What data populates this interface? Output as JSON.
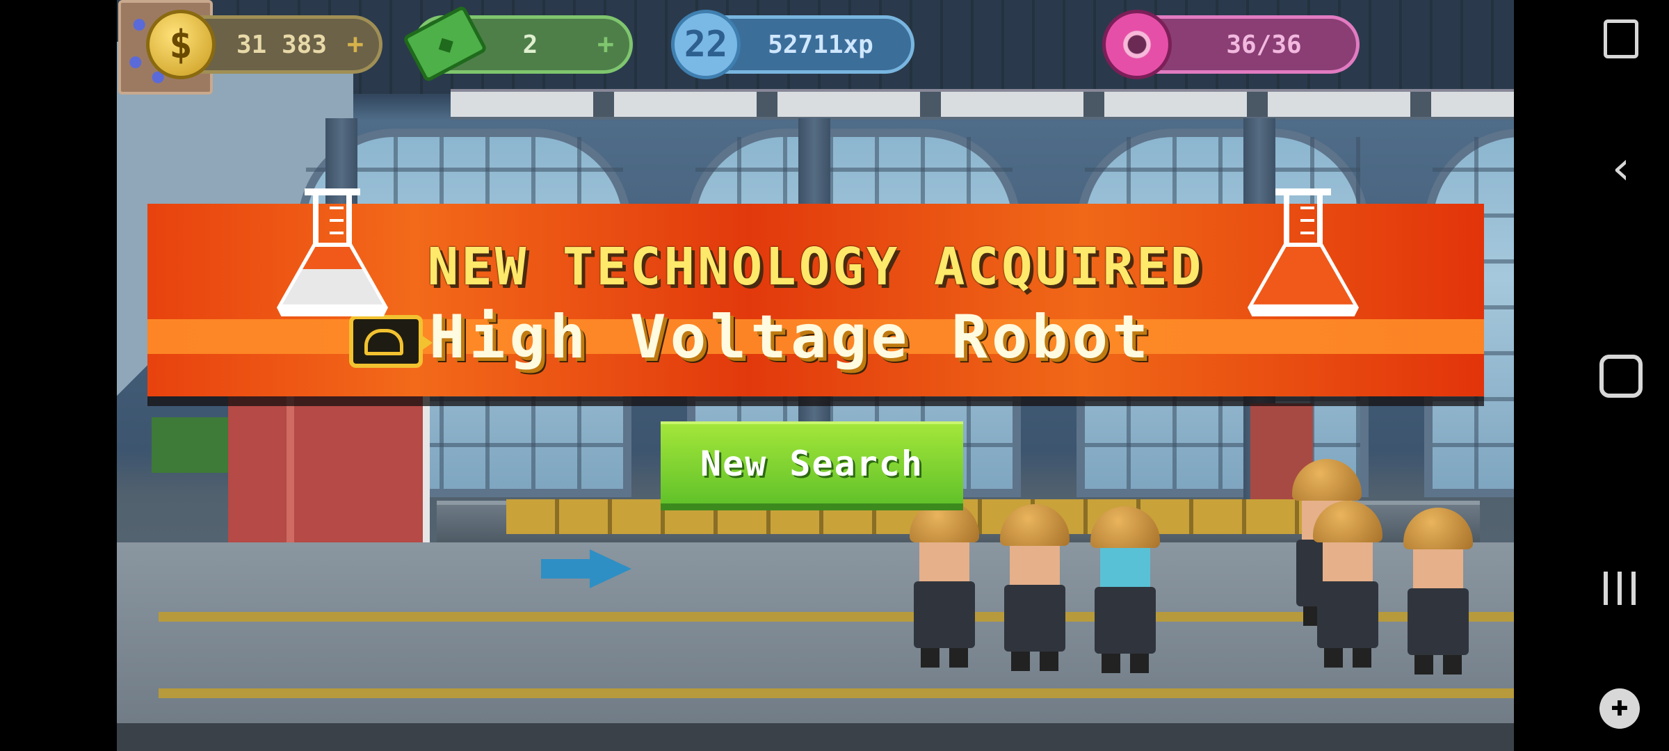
{
  "hud": {
    "coins": "31 383",
    "cash": "2",
    "level": "22",
    "xp": "52711xp",
    "donuts": "36/36",
    "plus": "+"
  },
  "banner": {
    "title": "NEW TECHNOLOGY ACQUIRED",
    "technology": "High Voltage Robot"
  },
  "buttons": {
    "new_search": "New Search"
  },
  "system_nav": {
    "back": "‹",
    "game_tools": "✚"
  },
  "colors": {
    "banner_orange": "#e8420e",
    "banner_title_yellow": "#ffe96a",
    "button_green": "#7fd232",
    "donut_pink": "#e64fa8"
  },
  "icons": [
    "coin-icon",
    "cash-icon",
    "level-icon",
    "donut-icon",
    "flask-icon",
    "robot-tech-icon",
    "back-icon",
    "home-icon",
    "recent-apps-icon",
    "screenshot-icon",
    "game-tools-icon"
  ]
}
